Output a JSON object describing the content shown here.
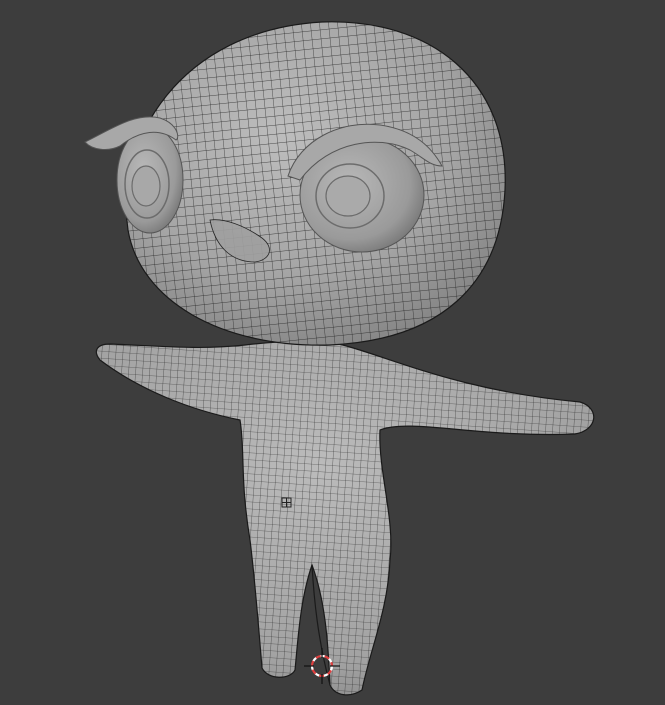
{
  "viewport": {
    "background_color": "#3d3d3d",
    "mesh_fill_color": "#a9a9a9",
    "wire_color": "#1a1a1a",
    "eye_fill_color": "#9e9e9e",
    "cursor_color_primary": "#e04040",
    "cursor_color_secondary": "#ffffff",
    "object": "character-mesh",
    "shading": "solid-wireframe"
  },
  "icons": {
    "cursor": "3d-cursor-icon",
    "origin": "object-origin-icon"
  }
}
